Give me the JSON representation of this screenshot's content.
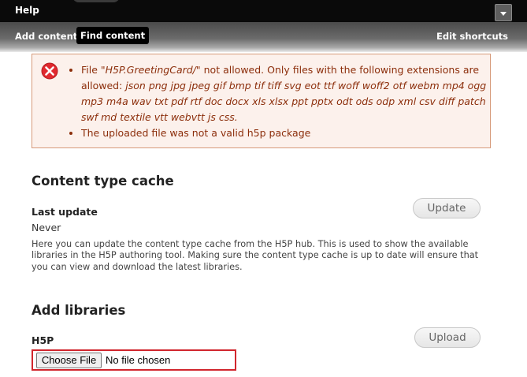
{
  "toolbar": {
    "help_label": "Help"
  },
  "shortcuts": {
    "add_content": "Add content",
    "find_content": "Find content",
    "edit_shortcuts": "Edit shortcuts"
  },
  "error": {
    "line1_prefix": "File \"",
    "line1_filename": "H5P.GreetingCard/",
    "line1_suffix": "\" not allowed. Only files with the following extensions are allowed: ",
    "line1_extensions": "json png jpg jpeg gif bmp tif tiff svg eot ttf woff woff2 otf webm mp4 ogg mp3 m4a wav txt pdf rtf doc docx xls xlsx ppt pptx odt ods odp xml csv diff patch swf md textile vtt webvtt js css.",
    "line2": "The uploaded file was not a valid h5p package"
  },
  "cache_section": {
    "title": "Content type cache",
    "last_update_label": "Last update",
    "last_update_value": "Never",
    "update_button": "Update",
    "description": "Here you can update the content type cache from the H5P hub. This is used to show the available libraries in the H5P authoring tool. Making sure the content type cache is up to date will ensure that you can view and download the latest libraries."
  },
  "libraries_section": {
    "title": "Add libraries",
    "file_label": "H5P",
    "choose_file_button": "Choose File",
    "no_file_text": "No file chosen",
    "upload_button": "Upload"
  }
}
